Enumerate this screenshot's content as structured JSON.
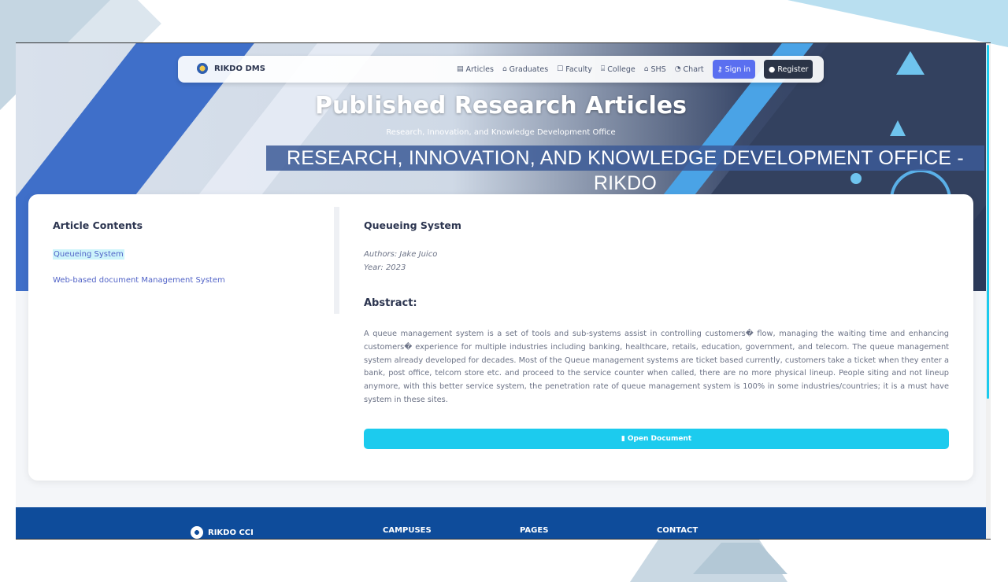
{
  "nav": {
    "brand": "RIKDO DMS",
    "links": [
      {
        "label": "Articles",
        "icon": "book-icon"
      },
      {
        "label": "Graduates",
        "icon": "graduation-cap-icon"
      },
      {
        "label": "Faculty",
        "icon": "chalkboard-icon"
      },
      {
        "label": "College",
        "icon": "institution-icon"
      },
      {
        "label": "SHS",
        "icon": "school-icon"
      },
      {
        "label": "Chart",
        "icon": "pie-chart-icon"
      }
    ],
    "signin": "Sign in",
    "register": "Register"
  },
  "hero": {
    "title": "Published Research Articles",
    "subtitle": "Research, Innovation, and Knowledge Development Office",
    "banner": "RESEARCH, INNOVATION, AND KNOWLEDGE DEVELOPMENT OFFICE - RIKDO"
  },
  "sidebar": {
    "title": "Article Contents",
    "items": [
      {
        "label": "Queueing System",
        "active": true
      },
      {
        "label": "Web-based document Management System",
        "active": false
      }
    ]
  },
  "article": {
    "title": "Queueing System",
    "authors": "Authors: Jake Juico",
    "year": "Year: 2023",
    "abstract_heading": "Abstract:",
    "abstract": "A queue management system is a set of tools and sub-systems assist in controlling customers� flow, managing the waiting time and enhancing customers� experience for multiple industries including banking, healthcare, retails, education, government, and telecom. The queue management system already developed for decades. Most of the Queue management systems are ticket based currently, customers take a ticket when they enter a bank, post office, telcom store etc. and proceed to the service counter when called, there are no more physical lineup. People siting and not lineup anymore, with this better service system, the penetration rate of queue management system is 100% in some industries/countries; it is a must have system in these sites.",
    "open_button": "Open Document"
  },
  "footer": {
    "brand": "RIKDO CCI",
    "campuses": "CAMPUSES",
    "pages": "PAGES",
    "contact": "CONTACT"
  },
  "colors": {
    "accent": "#1ccbee",
    "signin": "#5a6ff0",
    "register": "#2b3447",
    "footer": "#0e4c9b"
  }
}
